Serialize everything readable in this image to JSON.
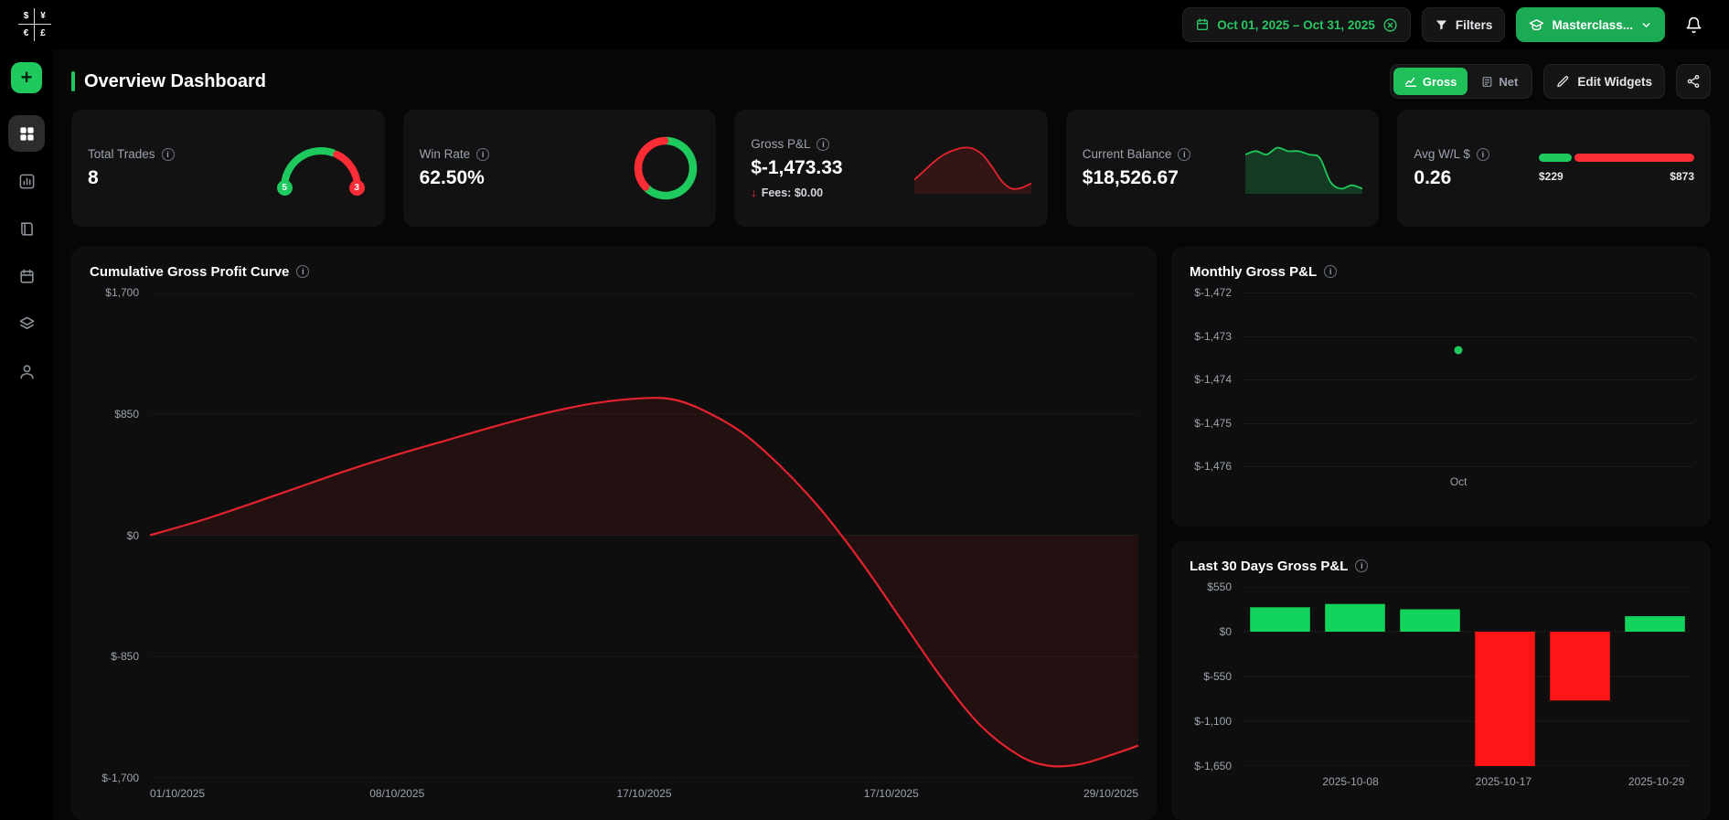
{
  "colors": {
    "green": "#1ec95e",
    "red": "#fb2c36",
    "bar_red": "#fe1616",
    "bar_green": "#12d45c",
    "line_red": "#e5232e"
  },
  "icons": {
    "add_label": "+",
    "info_glyph": "i"
  },
  "topbar": {
    "logo_symbols": [
      "$",
      "¥",
      "€",
      "£"
    ],
    "date_range": "Oct 01, 2025 – Oct 31, 2025",
    "filters_label": "Filters",
    "account_label": "Masterclass..."
  },
  "header": {
    "title": "Overview Dashboard",
    "gross_label": "Gross",
    "net_label": "Net",
    "edit_widgets_label": "Edit Widgets"
  },
  "stats": {
    "total_trades": {
      "label": "Total Trades",
      "value": "8",
      "wins": "5",
      "losses": "3",
      "win_pct": 62.5
    },
    "win_rate": {
      "label": "Win Rate",
      "value": "62.50%",
      "pct": 62.5
    },
    "gross_pnl": {
      "label": "Gross P&L",
      "value": "$-1,473.33",
      "fees_label": "Fees: $0.00",
      "spark": [
        0,
        10,
        20,
        28,
        33,
        36,
        35,
        28,
        14,
        -2,
        -10,
        -9,
        -4
      ]
    },
    "current_balance": {
      "label": "Current Balance",
      "value": "$18,526.67",
      "spark": [
        40,
        41,
        40,
        42,
        41,
        41,
        40,
        39,
        32,
        30,
        31,
        30
      ]
    },
    "avg_wl": {
      "label": "Avg W/L $",
      "value": "0.26",
      "avg_win": "$229",
      "avg_loss": "$873",
      "win_ratio": 0.21
    }
  },
  "chart_data": [
    {
      "id": "cumulative_gross_profit",
      "type": "line",
      "title": "Cumulative Gross Profit Curve",
      "ylim": [
        -1700,
        1700
      ],
      "yticks": [
        "$1,700",
        "$850",
        "$0",
        "$-850",
        "$-1,700"
      ],
      "xticks": [
        "01/10/2025",
        "08/10/2025",
        "17/10/2025",
        "17/10/2025",
        "29/10/2025"
      ],
      "grid": true,
      "points": [
        [
          0,
          0
        ],
        [
          0.05,
          100
        ],
        [
          0.1,
          215
        ],
        [
          0.15,
          335
        ],
        [
          0.2,
          455
        ],
        [
          0.25,
          565
        ],
        [
          0.3,
          665
        ],
        [
          0.35,
          765
        ],
        [
          0.4,
          855
        ],
        [
          0.45,
          925
        ],
        [
          0.5,
          960
        ],
        [
          0.53,
          950
        ],
        [
          0.56,
          875
        ],
        [
          0.6,
          715
        ],
        [
          0.64,
          470
        ],
        [
          0.68,
          170
        ],
        [
          0.72,
          -190
        ],
        [
          0.76,
          -590
        ],
        [
          0.8,
          -990
        ],
        [
          0.84,
          -1330
        ],
        [
          0.88,
          -1545
        ],
        [
          0.91,
          -1615
        ],
        [
          0.94,
          -1605
        ],
        [
          0.97,
          -1545
        ],
        [
          1,
          -1473.33
        ]
      ]
    },
    {
      "id": "monthly_gross_pnl",
      "type": "scatter",
      "title": "Monthly Gross P&L",
      "ylim": [
        -1476,
        -1472
      ],
      "yticks": [
        "$-1,472",
        "$-1,473",
        "$-1,474",
        "$-1,475",
        "$-1,476"
      ],
      "xticks": [
        "Oct"
      ],
      "grid": true,
      "points": [
        {
          "x": 0.48,
          "label": "Oct",
          "value": -1473.33
        }
      ]
    },
    {
      "id": "last_30_days_gross_pnl",
      "type": "bar",
      "title": "Last 30 Days Gross P&L",
      "ylim": [
        -1650,
        550
      ],
      "yticks": [
        "$550",
        "$0",
        "$-550",
        "$-1,100",
        "$-1,650"
      ],
      "values": [
        300,
        340,
        275,
        -1650,
        -845,
        190
      ],
      "xticks": [
        {
          "label": "2025-10-08",
          "pos": 0.24
        },
        {
          "label": "2025-10-17",
          "pos": 0.58
        },
        {
          "label": "2025-10-29",
          "pos": 0.92
        }
      ],
      "grid": true
    }
  ]
}
